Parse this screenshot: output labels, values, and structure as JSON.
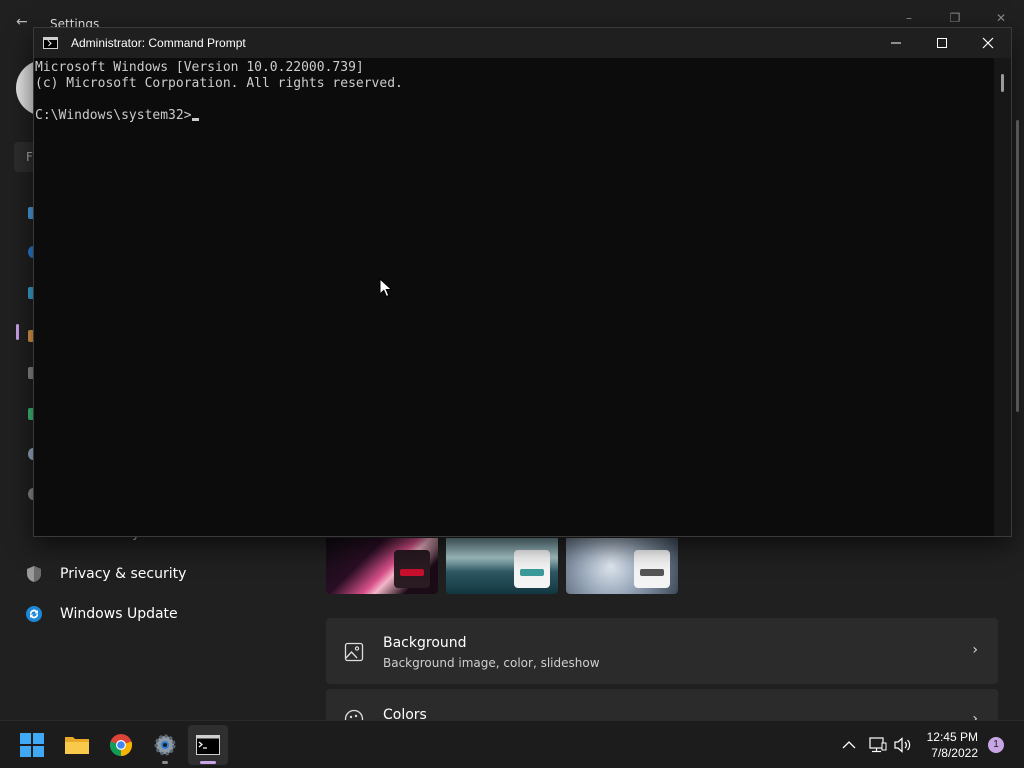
{
  "settings": {
    "title": "Settings",
    "nav": {
      "accessibility": "Accessibility",
      "privacy": "Privacy & security",
      "update": "Windows Update"
    },
    "cards": {
      "background_title": "Background",
      "background_sub": "Background image, color, slideshow",
      "colors_title": "Colors"
    }
  },
  "cmd": {
    "title": "Administrator: Command Prompt",
    "lines": [
      "Microsoft Windows [Version 10.0.22000.739]",
      "(c) Microsoft Corporation. All rights reserved.",
      "",
      "C:\\Windows\\system32>"
    ]
  },
  "taskbar": {
    "time": "12:45 PM",
    "date": "7/8/2022",
    "notification_count": "1",
    "accent": "#c8a6e6"
  }
}
